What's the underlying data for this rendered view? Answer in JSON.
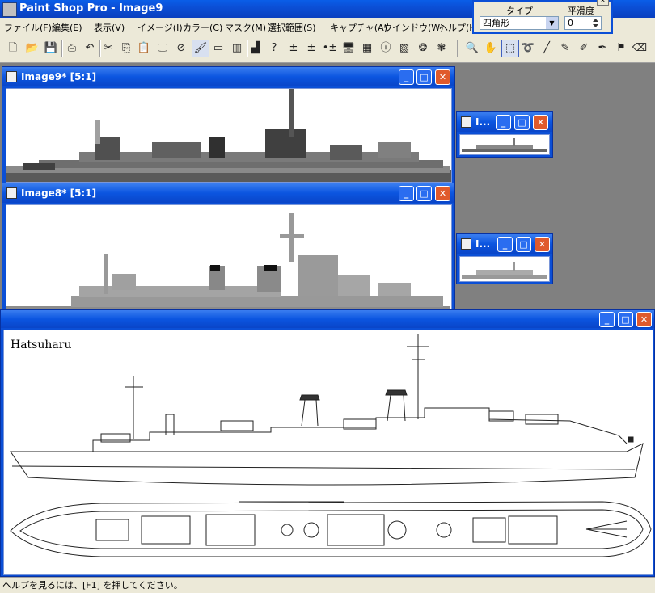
{
  "app": {
    "title": "Paint Shop Pro - Image9"
  },
  "menu": [
    "ファイル(F)",
    "編集(E)",
    "表示(V)",
    "イメージ(I)",
    "カラー(C)",
    "マスク(M)",
    "選択範囲(S)",
    "キャプチャ(A)",
    "ウインドウ(W)",
    "ヘルプ(H)"
  ],
  "options_palette": {
    "type_label": "タイプ",
    "type_value": "四角形",
    "smooth_label": "平滑度",
    "smooth_value": "0"
  },
  "windows": {
    "image9": {
      "title": "Image9* [5:1]"
    },
    "image8": {
      "title": "Image8* [5:1]"
    },
    "thumb1": {
      "title": "I..."
    },
    "thumb2": {
      "title": "I..."
    }
  },
  "main_image": {
    "caption": "Hatsuharu"
  },
  "status": {
    "text": "ヘルプを見るには、[F1] を押してください。"
  },
  "colors": {
    "title_blue": "#0b4fd6",
    "chrome": "#ece9d8",
    "workspace": "#808080",
    "close_red": "#e05a2c"
  }
}
